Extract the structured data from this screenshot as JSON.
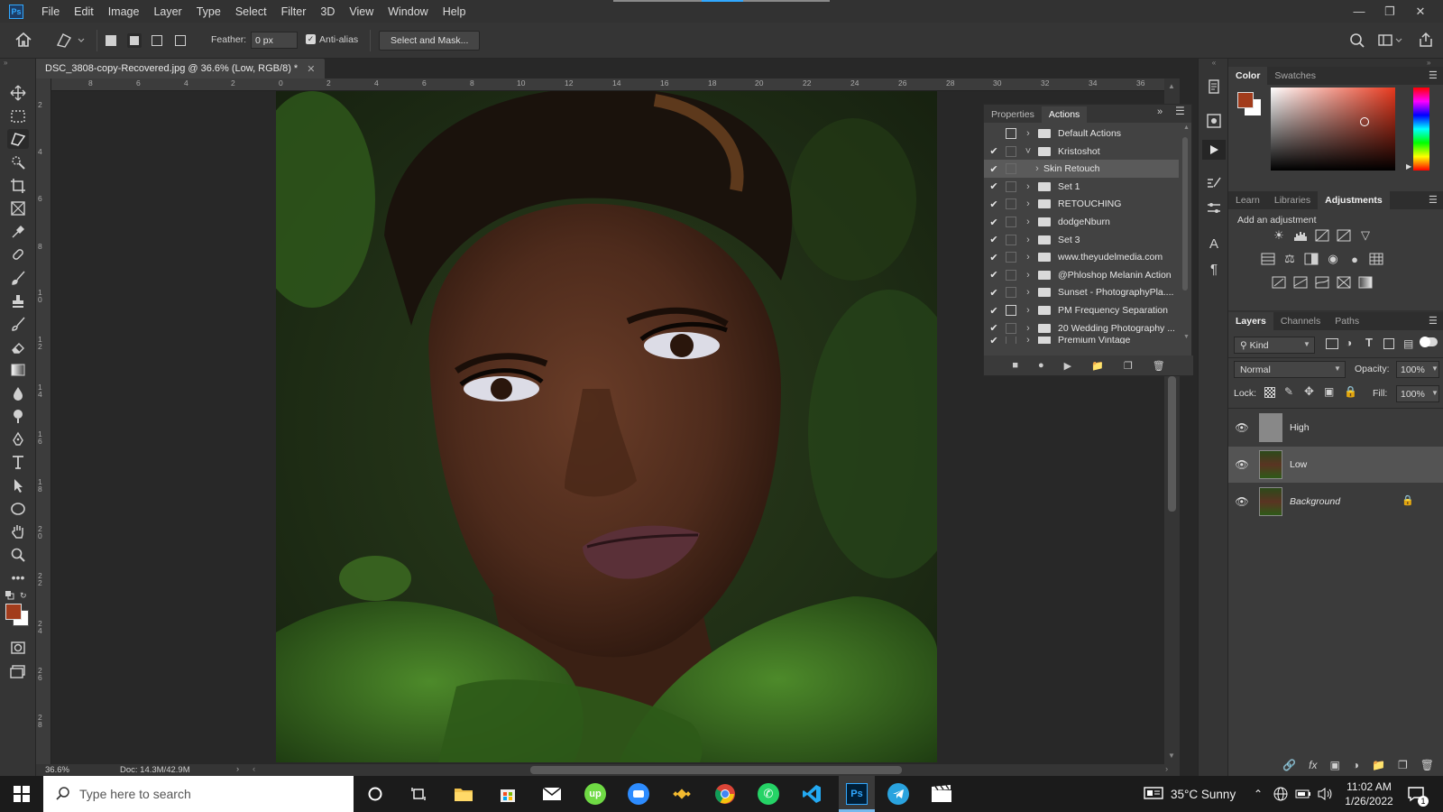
{
  "app": {
    "logo": "Ps"
  },
  "menubar": {
    "items": [
      "File",
      "Edit",
      "Image",
      "Layer",
      "Type",
      "Select",
      "Filter",
      "3D",
      "View",
      "Window",
      "Help"
    ]
  },
  "options": {
    "feather_label": "Feather:",
    "feather_value": "0 px",
    "antialias_label": "Anti-alias",
    "select_mask_label": "Select and Mask..."
  },
  "document": {
    "tab_title": "DSC_3808-copy-Recovered.jpg @ 36.6% (Low, RGB/8) *",
    "zoom": "36.6%",
    "doc_size": "Doc: 14.3M/42.9M"
  },
  "rulers": {
    "horizontal": [
      "8",
      "6",
      "4",
      "2",
      "0",
      "2",
      "4",
      "6",
      "8",
      "10",
      "12",
      "14",
      "16",
      "18",
      "20",
      "22",
      "24",
      "26",
      "28",
      "30",
      "32",
      "34",
      "36"
    ],
    "vertical": [
      "2",
      "4",
      "6",
      "8",
      "1 0",
      "1 2",
      "1 4",
      "1 6",
      "1 8",
      "2 0",
      "2 2",
      "2 4",
      "2 6",
      "2 8"
    ]
  },
  "actions_panel": {
    "tabs": [
      "Properties",
      "Actions"
    ],
    "active_tab": "Actions",
    "rows": [
      {
        "label": "Default Actions",
        "checked": false,
        "dialog": true,
        "expanded": false,
        "type": "set"
      },
      {
        "label": "Kristoshot",
        "checked": true,
        "dialog": false,
        "expanded": true,
        "type": "set"
      },
      {
        "label": "Skin Retouch",
        "checked": true,
        "dialog": false,
        "expanded": false,
        "type": "action"
      },
      {
        "label": "Set 1",
        "checked": true,
        "dialog": false,
        "expanded": false,
        "type": "set"
      },
      {
        "label": "RETOUCHING",
        "checked": true,
        "dialog": false,
        "expanded": false,
        "type": "set"
      },
      {
        "label": "dodgeNburn",
        "checked": true,
        "dialog": false,
        "expanded": false,
        "type": "set"
      },
      {
        "label": "Set 3",
        "checked": true,
        "dialog": false,
        "expanded": false,
        "type": "set"
      },
      {
        "label": "www.theyudelmedia.com",
        "checked": true,
        "dialog": false,
        "expanded": false,
        "type": "set"
      },
      {
        "label": "@Phloshop Melanin Action",
        "checked": true,
        "dialog": false,
        "expanded": false,
        "type": "set"
      },
      {
        "label": "Sunset - PhotographyPla....",
        "checked": true,
        "dialog": false,
        "expanded": false,
        "type": "set"
      },
      {
        "label": "PM Frequency Separation",
        "checked": true,
        "dialog": true,
        "expanded": false,
        "type": "set"
      },
      {
        "label": "20 Wedding Photography ...",
        "checked": true,
        "dialog": false,
        "expanded": false,
        "type": "set"
      },
      {
        "label": "Premium Vintage",
        "checked": true,
        "dialog": false,
        "expanded": false,
        "type": "set"
      }
    ]
  },
  "color_panel": {
    "tabs": [
      "Color",
      "Swatches"
    ],
    "active_tab": "Color",
    "foreground": "#a23c1c",
    "background": "#ffffff"
  },
  "adjustments_panel": {
    "tabs": [
      "Learn",
      "Libraries",
      "Adjustments"
    ],
    "active_tab": "Adjustments",
    "heading": "Add an adjustment"
  },
  "layers_panel": {
    "tabs": [
      "Layers",
      "Channels",
      "Paths"
    ],
    "active_tab": "Layers",
    "filter_label": "Kind",
    "blend_mode": "Normal",
    "opacity_label": "Opacity:",
    "opacity_value": "100%",
    "lock_label": "Lock:",
    "fill_label": "Fill:",
    "fill_value": "100%",
    "layers": [
      {
        "name": "High",
        "visible": true,
        "selected": false,
        "locked": false
      },
      {
        "name": "Low",
        "visible": true,
        "selected": true,
        "locked": false
      },
      {
        "name": "Background",
        "visible": true,
        "selected": false,
        "locked": true
      }
    ]
  },
  "taskbar": {
    "search_placeholder": "Type here to search",
    "weather": "35°C  Sunny",
    "time": "11:02 AM",
    "date": "1/26/2022",
    "notification_count": "1"
  }
}
